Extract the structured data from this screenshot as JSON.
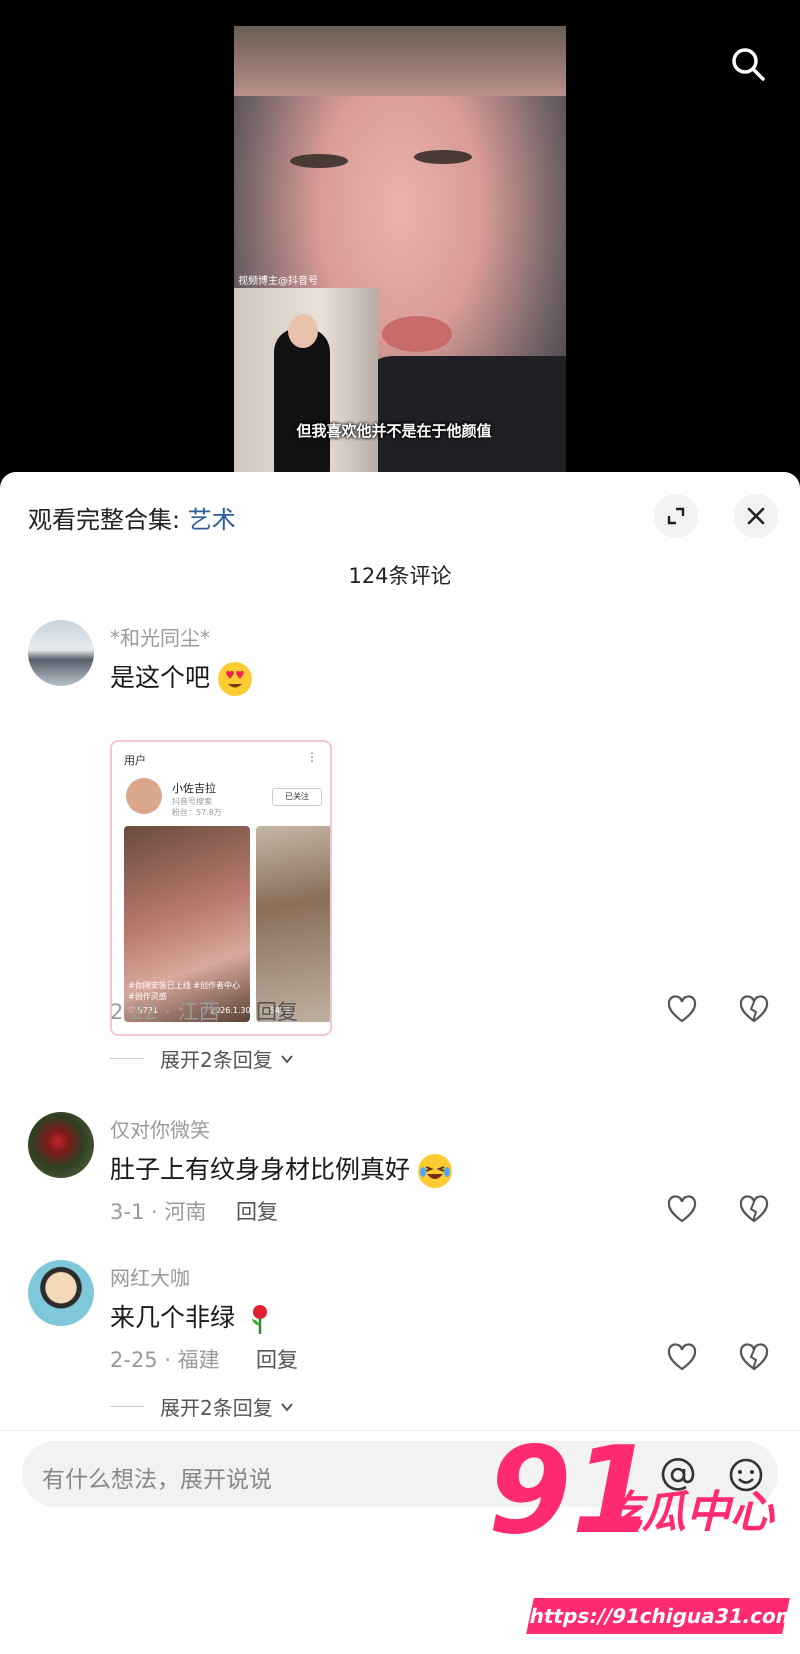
{
  "video": {
    "pip_tag": "视频博主@抖音号",
    "subtitle": "但我喜欢他并不是在于他颜值"
  },
  "sheet": {
    "collection_prefix": "观看完整合集: ",
    "collection_tag": "艺术",
    "comment_count": "124条评论"
  },
  "comments": [
    {
      "username": "*和光同尘*",
      "text": "是这个吧",
      "date_location": "2-22 · 江西",
      "reply_label": "回复",
      "more_replies": "展开2条回复",
      "screenshot": {
        "header": "用户",
        "dots": "⋮",
        "name": "小佐吉拉",
        "sub1": "抖音号搜索",
        "sub2": "粉丝：57.8万",
        "follow": "已关注",
        "caption": "#你刚安装已上线 #创作者中心 #创作灵感",
        "likes1": "♡ 9731",
        "date1": "2026.1.30",
        "likes2": "♡ 5478"
      }
    },
    {
      "username": "仅对你微笑",
      "text": "肚子上有纹身身材比例真好",
      "date_location": "3-1 · 河南",
      "reply_label": "回复"
    },
    {
      "username": "网红大咖",
      "text": "来几个非绿",
      "date_location": "2-25 · 福建",
      "reply_label": "回复",
      "more_replies": "展开2条回复"
    }
  ],
  "input": {
    "placeholder": "有什么想法，展开说说"
  },
  "watermark": {
    "number": "91",
    "text": "吃瓜中心",
    "url": "https://91chigua31.com"
  },
  "colors": {
    "accent_link": "#2c5c9c",
    "watermark": "#ff2a6f"
  },
  "icons": [
    "search-icon",
    "expand-icon",
    "close-icon",
    "heart-icon",
    "broken-heart-icon",
    "chevron-down-icon",
    "at-icon",
    "emoji-icon"
  ]
}
